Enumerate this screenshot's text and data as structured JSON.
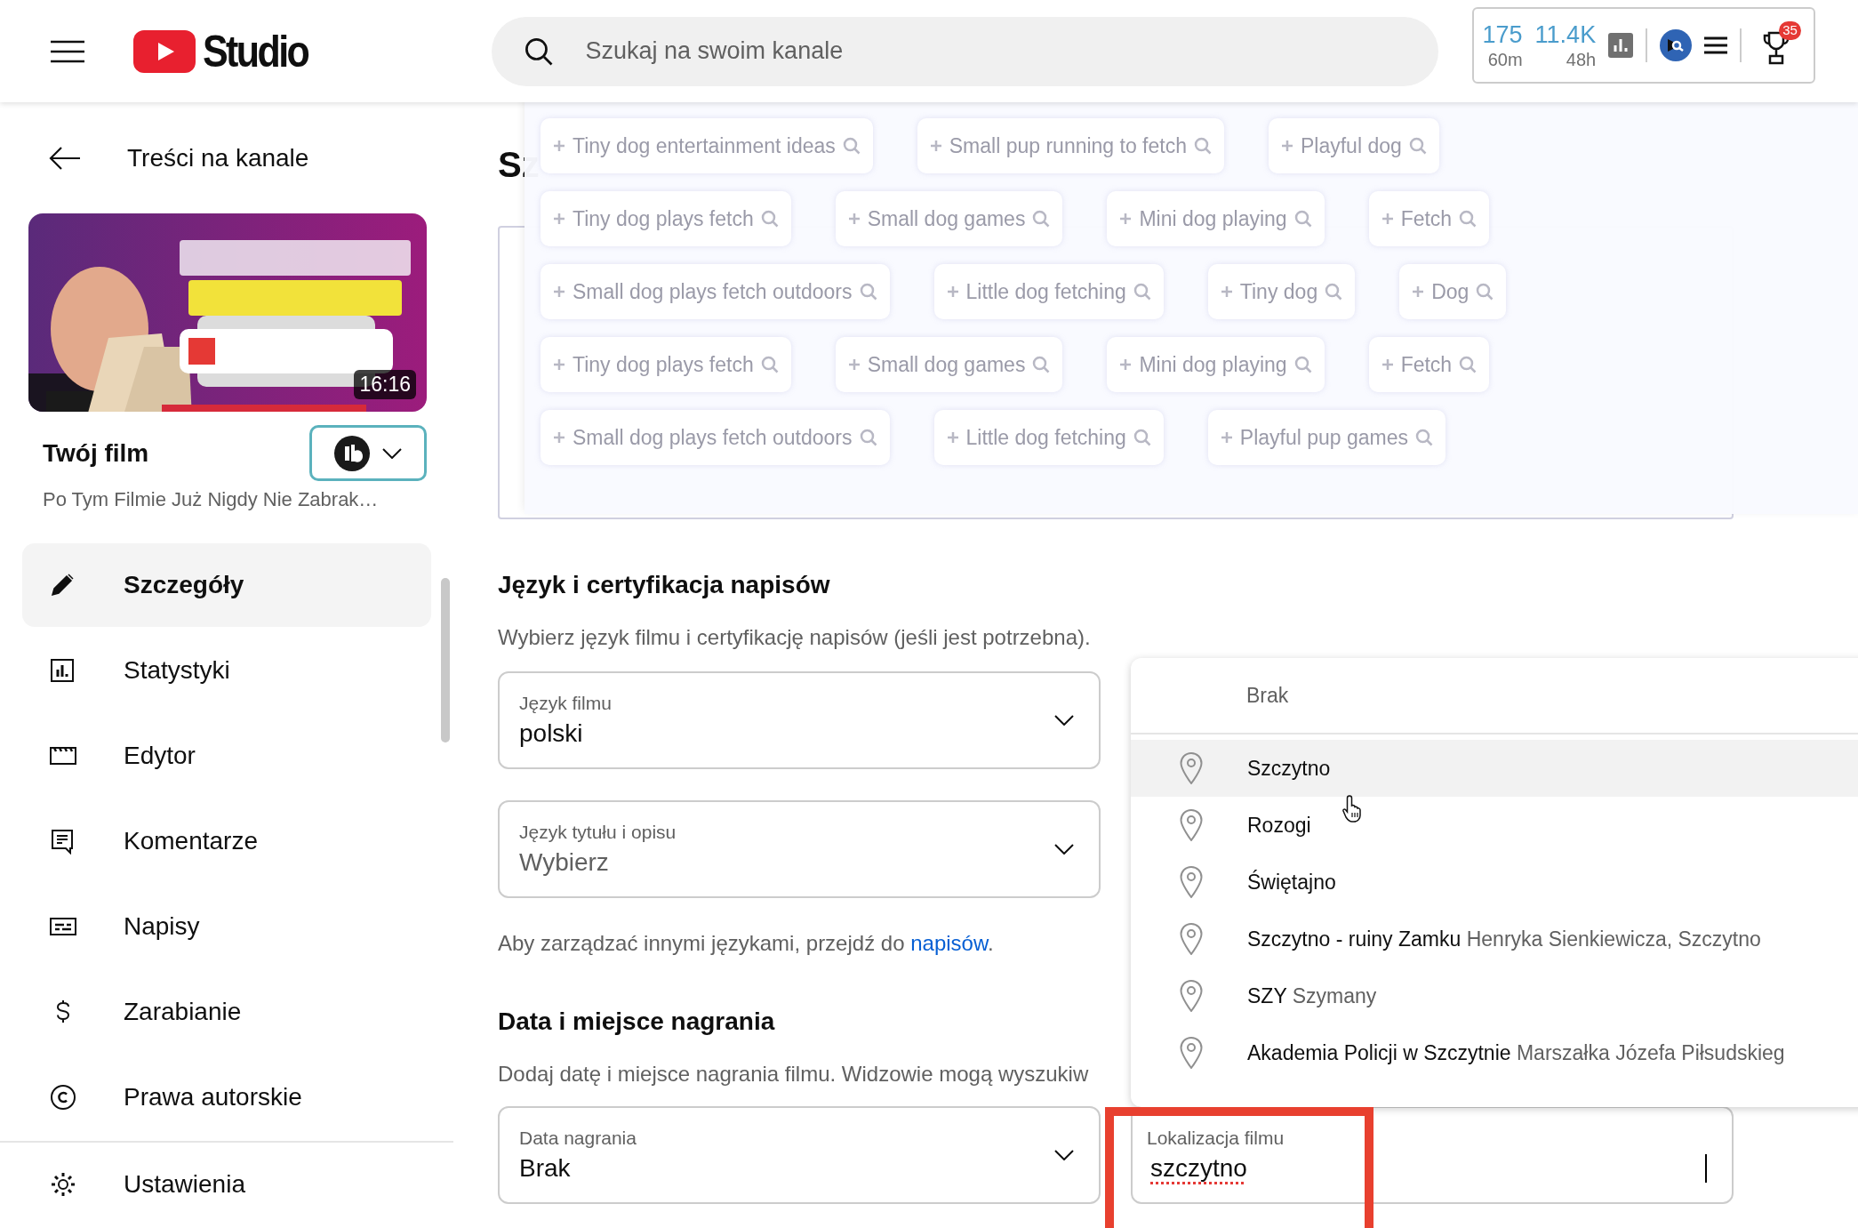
{
  "topbar": {
    "logo_text": "Studio",
    "search": {
      "placeholder": "Szukaj na swoim kanale"
    },
    "stats": [
      {
        "value": "175",
        "period": "60m"
      },
      {
        "value": "11.4K",
        "period": "48h"
      }
    ],
    "trophy_badge": "35"
  },
  "sidebar": {
    "back_label": "Treści na kanale",
    "video": {
      "duration": "16:16",
      "title": "Twój film",
      "subtitle": "Po Tym Filmie Już Nigdy Nie Zabrak…"
    },
    "nav": [
      {
        "label": "Szczegóły",
        "selected": true
      },
      {
        "label": "Statystyki",
        "selected": false
      },
      {
        "label": "Edytor",
        "selected": false
      },
      {
        "label": "Komentarze",
        "selected": false
      },
      {
        "label": "Napisy",
        "selected": false
      },
      {
        "label": "Zarabianie",
        "selected": false
      },
      {
        "label": "Prawa autorskie",
        "selected": false
      },
      {
        "label": "Ustawienia",
        "selected": false
      }
    ]
  },
  "main": {
    "heading": "Sz",
    "tag_suggestions": [
      [
        "Tiny dog entertainment ideas",
        "Small pup running to fetch",
        "Playful dog"
      ],
      [
        "Tiny dog plays fetch",
        "Small dog games",
        "Mini dog playing",
        "Fetch"
      ],
      [
        "Small dog plays fetch outdoors",
        "Little dog fetching",
        "Tiny dog",
        "Dog"
      ],
      [
        "Tiny dog plays fetch",
        "Small dog games",
        "Mini dog playing",
        "Fetch"
      ],
      [
        "Small dog plays fetch outdoors",
        "Little dog fetching",
        "Playful pup games"
      ]
    ],
    "language_section": {
      "title": "Język i certyfikacja napisów",
      "description": "Wybierz język filmu i certyfikację napisów (jeśli jest potrzebna).",
      "fields": [
        {
          "label": "Język filmu",
          "value": "polski"
        },
        {
          "label": "Język tytułu i opisu",
          "placeholder": "Wybierz"
        }
      ],
      "note": {
        "text": "Aby zarządzać innymi językami, przejdź do ",
        "link": "napisów",
        "end": "."
      }
    },
    "recording_section": {
      "title": "Data i miejsce nagrania",
      "description": "Dodaj datę i miejsce nagrania filmu. Widzowie mogą wyszukiw",
      "date_field": {
        "label": "Data nagrania",
        "value": "Brak"
      },
      "location_field": {
        "label": "Lokalizacja filmu",
        "value": "szczytno",
        "highlighted": true
      }
    },
    "location_dropdown": {
      "none_option": "Brak",
      "options": [
        {
          "name": "Szczytno",
          "highlighted": true
        },
        {
          "name": "Rozogi",
          "highlighted": false
        },
        {
          "name": "Świętajno",
          "highlighted": false
        },
        {
          "name": "Szczytno - ruiny Zamku",
          "detail": "Henryka Sienkiewicza, Szczytno",
          "highlighted": false
        },
        {
          "name": "SZY",
          "detail": "Szymany",
          "highlighted": false
        },
        {
          "name": "Akademia Policji w Szczytnie",
          "detail": "Marszałka Józefa Piłsudskieg",
          "highlighted": false
        }
      ]
    }
  }
}
